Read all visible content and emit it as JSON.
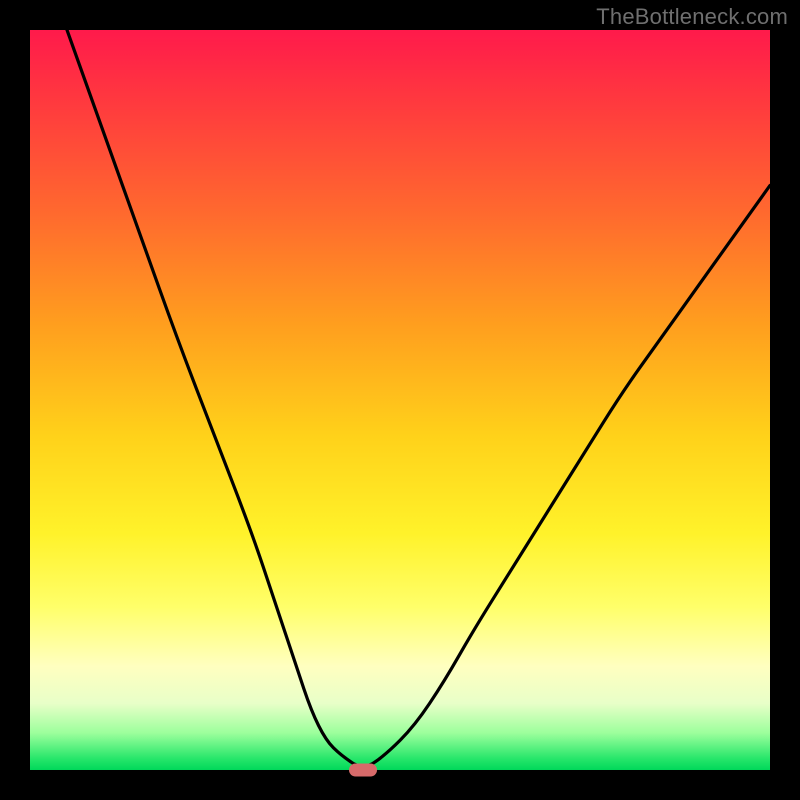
{
  "watermark": "TheBottleneck.com",
  "chart_data": {
    "type": "line",
    "title": "",
    "xlabel": "",
    "ylabel": "",
    "xlim": [
      0,
      100
    ],
    "ylim": [
      0,
      100
    ],
    "grid": false,
    "legend": false,
    "series": [
      {
        "name": "bottleneck-curve",
        "x": [
          5,
          10,
          15,
          20,
          25,
          30,
          33,
          36,
          38,
          40,
          42,
          45,
          48,
          52,
          56,
          60,
          65,
          70,
          75,
          80,
          85,
          90,
          95,
          100
        ],
        "values": [
          100,
          86,
          72,
          58,
          45,
          32,
          23,
          14,
          8,
          4,
          2,
          0,
          2,
          6,
          12,
          19,
          27,
          35,
          43,
          51,
          58,
          65,
          72,
          79
        ]
      }
    ],
    "marker": {
      "x": 45,
      "y": 0
    },
    "gradient_stops": [
      {
        "pos": 0,
        "color": "#ff1a4b"
      },
      {
        "pos": 0.25,
        "color": "#ff6a2e"
      },
      {
        "pos": 0.55,
        "color": "#ffd21a"
      },
      {
        "pos": 0.78,
        "color": "#ffff6a"
      },
      {
        "pos": 0.95,
        "color": "#9cff9c"
      },
      {
        "pos": 1.0,
        "color": "#00d85a"
      }
    ]
  }
}
